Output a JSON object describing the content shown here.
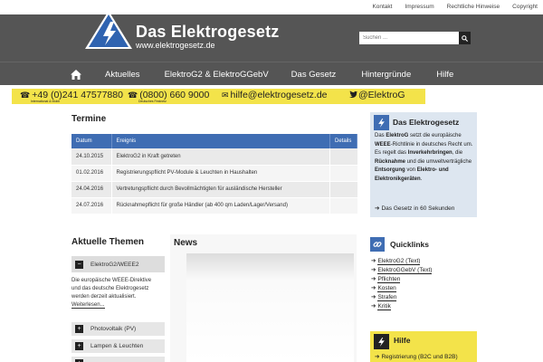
{
  "toplinks": [
    "Kontakt",
    "Impressum",
    "Rechtliche Hinweise",
    "Copyright"
  ],
  "header": {
    "title": "Das Elektrogesetz",
    "subtitle": "www.elektrogesetz.de",
    "search_placeholder": "Suchen ..."
  },
  "nav": {
    "items": [
      "Aktuelles",
      "ElektroG2 & ElektroGGebV",
      "Das Gesetz",
      "Hintergründe",
      "Hilfe"
    ]
  },
  "contact": {
    "phone1": "+49 (0)241 47577880",
    "phone1_note": "International & Mobil",
    "phone2": "(0800) 660 9000",
    "phone2_note": "Deutsches Festnetz",
    "email": "hilfe@elektrogesetz.de",
    "twitter": "@ElektroG"
  },
  "termine": {
    "title": "Termine",
    "columns": [
      "Datum",
      "Ereignis",
      "Details"
    ],
    "rows": [
      {
        "datum": "24.10.2015",
        "ereignis": "ElektroG2 in Kraft getreten"
      },
      {
        "datum": "01.02.2016",
        "ereignis": "Registrierungspflicht PV-Module & Leuchten in Haushalten"
      },
      {
        "datum": "24.04.2016",
        "ereignis": "Vertretungspflicht durch Bevollmächtigten für ausländische Hersteller"
      },
      {
        "datum": "24.07.2016",
        "ereignis": "Rücknahmepflicht für große Händler (ab 400 qm Laden/Lager/Versand)"
      }
    ]
  },
  "aktuelle_themen": {
    "title": "Aktuelle Themen",
    "open_item": "ElektroG2/WEEE2",
    "open_text_1": "Die europäische WEEE-Direktive",
    "open_text_2": "und das deutsche Elektrogesetz",
    "open_text_3": "werden derzeit aktualisiert.",
    "more": "Weiterlesen...",
    "items": [
      "Photovoltaik (PV)",
      "Lampen & Leuchten"
    ]
  },
  "news": {
    "title": "News"
  },
  "sidebar_info": {
    "title": "Das Elektrogesetz",
    "text_parts": [
      "Das ",
      "ElektroG",
      " setzt die europäische ",
      "WEEE",
      "-Richtlinie in deutsches Recht um. Es regelt das ",
      "Inverkehrbringen",
      ", die ",
      "Rücknahme",
      " und die umweltverträgliche ",
      "Entsorgung",
      " von ",
      "Elektro- und Elektronikgeräten",
      "."
    ],
    "link": "Das Gesetz in 60 Sekunden"
  },
  "quicklinks": {
    "title": "Quicklinks",
    "items": [
      "ElektroG2 (Text)",
      "ElektroGGebV (Text)",
      "Pflichten",
      "Kosten",
      "Strafen",
      "Kritik"
    ]
  },
  "hilfe": {
    "title": "Hilfe",
    "item": "Registrierung (B2C und B2B)"
  },
  "colors": {
    "header_bg": "#555555",
    "accent_blue": "#3f6db3",
    "accent_yellow": "#f3e34a",
    "sidebar_bg": "#dde6f0"
  }
}
